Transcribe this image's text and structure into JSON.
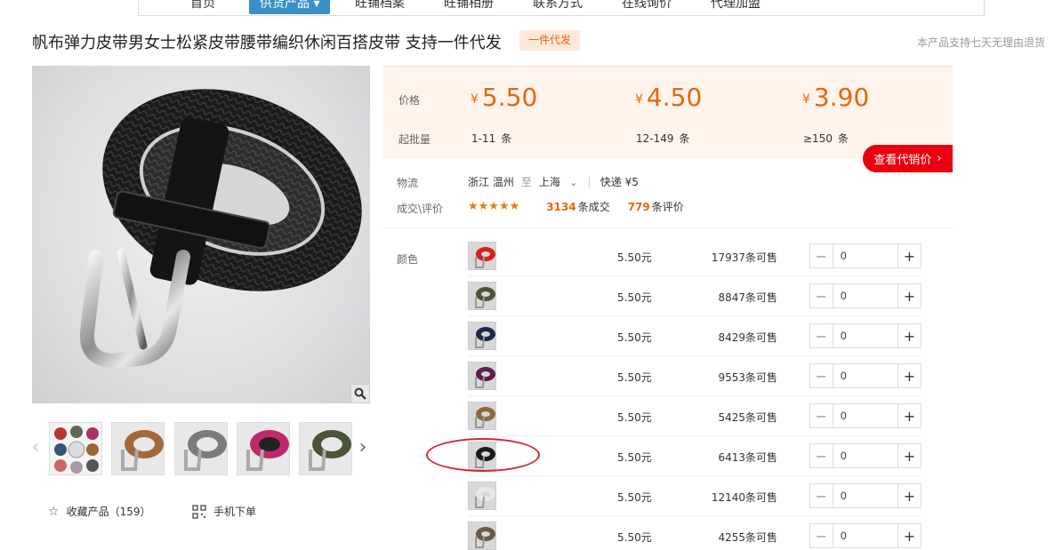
{
  "nav": [
    "首页",
    "供货产品 ▾",
    "旺铺档案",
    "旺铺相册",
    "联系方式",
    "在线询价",
    "代理加盟"
  ],
  "product": {
    "title": "帆布弹力皮带男女士松紧皮带腰带编织休闲百搭皮带 支持一件代发",
    "badge": "一件代发",
    "return_note": "本产品支持七天无理由退货"
  },
  "price_box": {
    "price_label": "价格",
    "moq_label": "起批量",
    "yen": "¥",
    "tiers": [
      {
        "price": "5.50",
        "range": "1-11",
        "unit": "条"
      },
      {
        "price": "4.50",
        "range": "12-149",
        "unit": "条"
      },
      {
        "price": "3.90",
        "range": "≥150",
        "unit": "条"
      }
    ],
    "agent_button": "查看代销价"
  },
  "logistics": {
    "label": "物流",
    "from": "浙江 温州",
    "to_word": "至",
    "to": "上海",
    "express": "快递 ¥5"
  },
  "reviews": {
    "label": "成交\\评价",
    "stars": "★★★★★",
    "deals": "3134",
    "deals_suffix": "条成交",
    "reviews": "779",
    "reviews_suffix": "条评价"
  },
  "color_label": "颜色",
  "skus": [
    {
      "price": "5.50元",
      "stock": "17937条可售",
      "qty": "0",
      "swatch": "#d81e1e"
    },
    {
      "price": "5.50元",
      "stock": "8847条可售",
      "qty": "0",
      "swatch": "#4b5437"
    },
    {
      "price": "5.50元",
      "stock": "8429条可售",
      "qty": "0",
      "swatch": "#1e2a4a"
    },
    {
      "price": "5.50元",
      "stock": "9553条可售",
      "qty": "0",
      "swatch": "#5a1f4f"
    },
    {
      "price": "5.50元",
      "stock": "5425条可售",
      "qty": "0",
      "swatch": "#8b6a3e"
    },
    {
      "price": "5.50元",
      "stock": "6413条可售",
      "qty": "0",
      "swatch": "#1a1a1a"
    },
    {
      "price": "5.50元",
      "stock": "12140条可售",
      "qty": "0",
      "swatch": "#e9e9e9"
    },
    {
      "price": "5.50元",
      "stock": "4255条可售",
      "qty": "0",
      "swatch": "#6b5a48"
    }
  ],
  "favorite": {
    "label": "收藏产品",
    "count": "（159）"
  },
  "mobile_order": "手机下单",
  "thumb_colors": [
    "#b34a5a",
    "#9c6a3a",
    "#7a7a7a",
    "#c0286e",
    "#4b5437"
  ]
}
